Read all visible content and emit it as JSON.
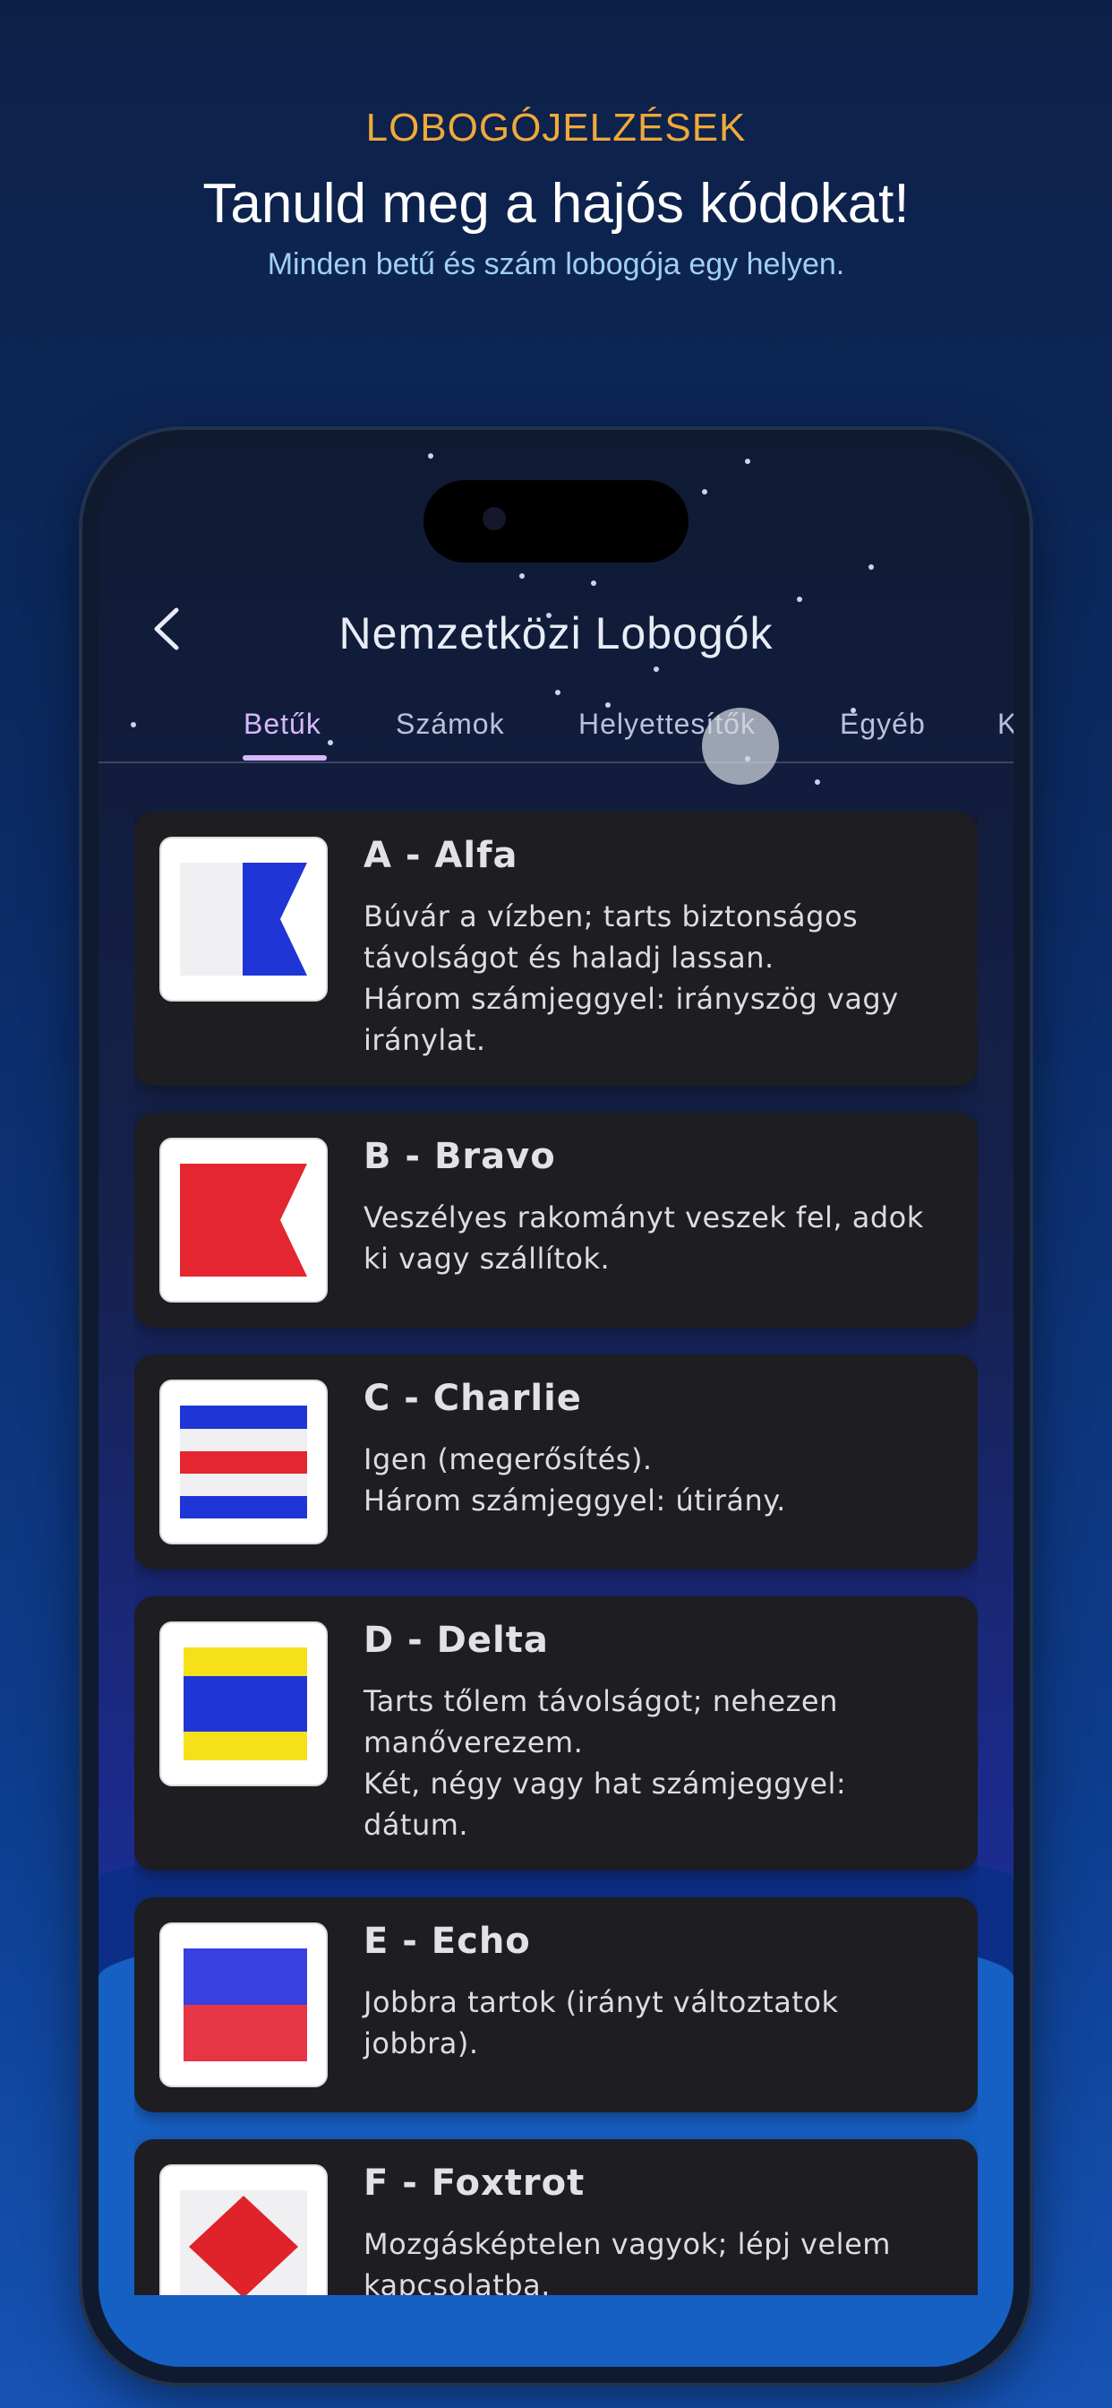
{
  "promo": {
    "kicker": "LOBOGÓJELZÉSEK",
    "title": "Tanuld meg a hajós kódokat!",
    "subtitle": "Minden betű és szám lobogója egy helyen."
  },
  "header": {
    "back_icon": "chevron-left-icon",
    "title": "Nemzetközi Lobogók"
  },
  "tabs": [
    {
      "label": "Betűk",
      "active": true
    },
    {
      "label": "Számok"
    },
    {
      "label": "Helyettesítők"
    },
    {
      "label": "Egyéb"
    },
    {
      "label": "K"
    }
  ],
  "flags": [
    {
      "title": "A - Alfa",
      "description": "Búvár a vízben; tarts biztonságos\ntávolságot és haladj lassan.\nHárom számjeggyel: irányszög vagy\niránylat.",
      "colors": [
        "#ffffff",
        "#1f35d6"
      ]
    },
    {
      "title": "B - Bravo",
      "description": "Veszélyes rakományt veszek fel, adok\nki vagy szállítok.",
      "colors": [
        "#e3262f"
      ]
    },
    {
      "title": "C - Charlie",
      "description": "Igen (megerősítés).\nHárom számjeggyel: útirány.",
      "colors": [
        "#1f35d6",
        "#ffffff",
        "#e3262f"
      ]
    },
    {
      "title": "D - Delta",
      "description": "Tarts tőlem távolságot; nehezen\nmanőverezem.\nKét, négy vagy hat számjeggyel:\ndátum.",
      "colors": [
        "#f6e01a",
        "#1f35d6"
      ]
    },
    {
      "title": "E - Echo",
      "description": "Jobbra tartok (irányt változtatok\njobbra).",
      "colors": [
        "#3a3fe0",
        "#e63545"
      ]
    },
    {
      "title": "F - Foxtrot",
      "description": "Mozgásképtelen vagyok; lépj velem\nkapcsolatba.",
      "colors": [
        "#ffffff",
        "#e0222a"
      ]
    }
  ]
}
